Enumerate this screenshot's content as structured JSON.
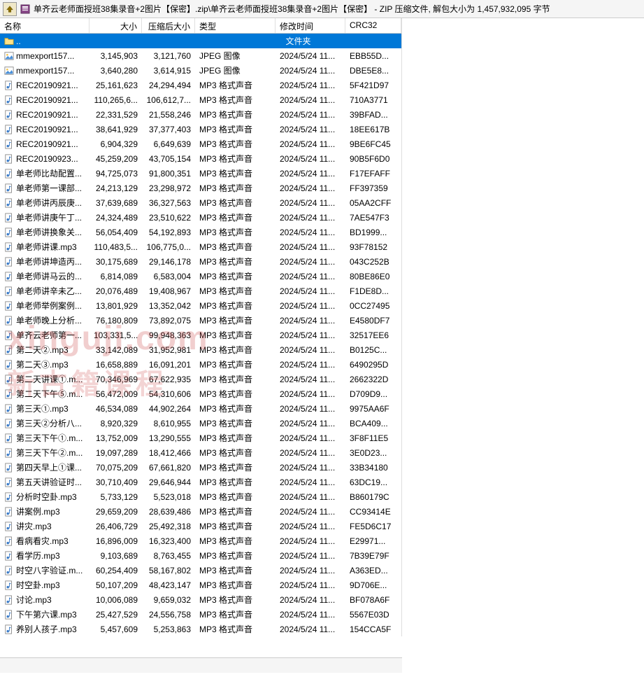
{
  "toolbar": {
    "title_path": "单齐云老师面授班38集录音+2图片【保密】.zip\\单齐云老师面授班38集录音+2图片【保密】 - ZIP 压缩文件, 解包大小为 1,457,932,095 字节"
  },
  "headers": {
    "name": "名称",
    "size": "大小",
    "packed": "压缩后大小",
    "type": "类型",
    "mtime": "修改时间",
    "crc": "CRC32"
  },
  "folder_row": {
    "dots": "..",
    "label": "文件夹"
  },
  "watermark1": "xinguji.com",
  "watermark2": "新古籍课程",
  "files": [
    {
      "name": "mmexport157...",
      "size": "3,145,903",
      "packed": "3,121,760",
      "type": "JPEG 图像",
      "mtime": "2024/5/24 11...",
      "crc": "EBB55D...",
      "icon": "img"
    },
    {
      "name": "mmexport157...",
      "size": "3,640,280",
      "packed": "3,614,915",
      "type": "JPEG 图像",
      "mtime": "2024/5/24 11...",
      "crc": "DBE5E8...",
      "icon": "img"
    },
    {
      "name": "REC20190921...",
      "size": "25,161,623",
      "packed": "24,294,494",
      "type": "MP3 格式声音",
      "mtime": "2024/5/24 11...",
      "crc": "5F421D97",
      "icon": "audio"
    },
    {
      "name": "REC20190921...",
      "size": "110,265,6...",
      "packed": "106,612,7...",
      "type": "MP3 格式声音",
      "mtime": "2024/5/24 11...",
      "crc": "710A3771",
      "icon": "audio"
    },
    {
      "name": "REC20190921...",
      "size": "22,331,529",
      "packed": "21,558,246",
      "type": "MP3 格式声音",
      "mtime": "2024/5/24 11...",
      "crc": "39BFAD...",
      "icon": "audio"
    },
    {
      "name": "REC20190921...",
      "size": "38,641,929",
      "packed": "37,377,403",
      "type": "MP3 格式声音",
      "mtime": "2024/5/24 11...",
      "crc": "18EE617B",
      "icon": "audio"
    },
    {
      "name": "REC20190921...",
      "size": "6,904,329",
      "packed": "6,649,639",
      "type": "MP3 格式声音",
      "mtime": "2024/5/24 11...",
      "crc": "9BE6FC45",
      "icon": "audio"
    },
    {
      "name": "REC20190923...",
      "size": "45,259,209",
      "packed": "43,705,154",
      "type": "MP3 格式声音",
      "mtime": "2024/5/24 11...",
      "crc": "90B5F6D0",
      "icon": "audio"
    },
    {
      "name": "单老师比劫配置...",
      "size": "94,725,073",
      "packed": "91,800,351",
      "type": "MP3 格式声音",
      "mtime": "2024/5/24 11...",
      "crc": "F17EFAFF",
      "icon": "audio"
    },
    {
      "name": "单老师第一课部...",
      "size": "24,213,129",
      "packed": "23,298,972",
      "type": "MP3 格式声音",
      "mtime": "2024/5/24 11...",
      "crc": "FF397359",
      "icon": "audio"
    },
    {
      "name": "单老师讲丙辰庚...",
      "size": "37,639,689",
      "packed": "36,327,563",
      "type": "MP3 格式声音",
      "mtime": "2024/5/24 11...",
      "crc": "05AA2CFF",
      "icon": "audio"
    },
    {
      "name": "单老师讲庚午丁...",
      "size": "24,324,489",
      "packed": "23,510,622",
      "type": "MP3 格式声音",
      "mtime": "2024/5/24 11...",
      "crc": "7AE547F3",
      "icon": "audio"
    },
    {
      "name": "单老师讲换象关...",
      "size": "56,054,409",
      "packed": "54,192,893",
      "type": "MP3 格式声音",
      "mtime": "2024/5/24 11...",
      "crc": "BD1999...",
      "icon": "audio"
    },
    {
      "name": "单老师讲课.mp3",
      "size": "110,483,5...",
      "packed": "106,775,0...",
      "type": "MP3 格式声音",
      "mtime": "2024/5/24 11...",
      "crc": "93F78152",
      "icon": "audio"
    },
    {
      "name": "单老师讲坤造丙...",
      "size": "30,175,689",
      "packed": "29,146,178",
      "type": "MP3 格式声音",
      "mtime": "2024/5/24 11...",
      "crc": "043C252B",
      "icon": "audio"
    },
    {
      "name": "单老师讲马云的...",
      "size": "6,814,089",
      "packed": "6,583,004",
      "type": "MP3 格式声音",
      "mtime": "2024/5/24 11...",
      "crc": "80BE86E0",
      "icon": "audio"
    },
    {
      "name": "单老师讲辛未乙...",
      "size": "20,076,489",
      "packed": "19,408,967",
      "type": "MP3 格式声音",
      "mtime": "2024/5/24 11...",
      "crc": "F1DE8D...",
      "icon": "audio"
    },
    {
      "name": "单老师举例案例...",
      "size": "13,801,929",
      "packed": "13,352,042",
      "type": "MP3 格式声音",
      "mtime": "2024/5/24 11...",
      "crc": "0CC27495",
      "icon": "audio"
    },
    {
      "name": "单老师晚上分析...",
      "size": "76,180,809",
      "packed": "73,892,075",
      "type": "MP3 格式声音",
      "mtime": "2024/5/24 11...",
      "crc": "E4580DF7",
      "icon": "audio"
    },
    {
      "name": "单齐云老师第一...",
      "size": "103,331,5...",
      "packed": "99,948,363",
      "type": "MP3 格式声音",
      "mtime": "2024/5/24 11...",
      "crc": "32517EE6",
      "icon": "audio"
    },
    {
      "name": "第二天②.mp3",
      "size": "33,142,089",
      "packed": "31,952,981",
      "type": "MP3 格式声音",
      "mtime": "2024/5/24 11...",
      "crc": "B0125C...",
      "icon": "audio"
    },
    {
      "name": "第二天③.mp3",
      "size": "16,658,889",
      "packed": "16,091,201",
      "type": "MP3 格式声音",
      "mtime": "2024/5/24 11...",
      "crc": "6490295D",
      "icon": "audio"
    },
    {
      "name": "第二天讲课①.m...",
      "size": "70,346,969",
      "packed": "67,622,935",
      "type": "MP3 格式声音",
      "mtime": "2024/5/24 11...",
      "crc": "2662322D",
      "icon": "audio"
    },
    {
      "name": "第二天下午⑤.m...",
      "size": "56,472,009",
      "packed": "54,310,606",
      "type": "MP3 格式声音",
      "mtime": "2024/5/24 11...",
      "crc": "D709D9...",
      "icon": "audio"
    },
    {
      "name": "第三天①.mp3",
      "size": "46,534,089",
      "packed": "44,902,264",
      "type": "MP3 格式声音",
      "mtime": "2024/5/24 11...",
      "crc": "9975AA6F",
      "icon": "audio"
    },
    {
      "name": "第三天②分析八...",
      "size": "8,920,329",
      "packed": "8,610,955",
      "type": "MP3 格式声音",
      "mtime": "2024/5/24 11...",
      "crc": "BCA409...",
      "icon": "audio"
    },
    {
      "name": "第三天下午①.m...",
      "size": "13,752,009",
      "packed": "13,290,555",
      "type": "MP3 格式声音",
      "mtime": "2024/5/24 11...",
      "crc": "3F8F11E5",
      "icon": "audio"
    },
    {
      "name": "第三天下午②.m...",
      "size": "19,097,289",
      "packed": "18,412,466",
      "type": "MP3 格式声音",
      "mtime": "2024/5/24 11...",
      "crc": "3E0D23...",
      "icon": "audio"
    },
    {
      "name": "第四天早上①课...",
      "size": "70,075,209",
      "packed": "67,661,820",
      "type": "MP3 格式声音",
      "mtime": "2024/5/24 11...",
      "crc": "33B34180",
      "icon": "audio"
    },
    {
      "name": "第五天讲验证时...",
      "size": "30,710,409",
      "packed": "29,646,944",
      "type": "MP3 格式声音",
      "mtime": "2024/5/24 11...",
      "crc": "63DC19...",
      "icon": "audio"
    },
    {
      "name": "分析时空卦.mp3",
      "size": "5,733,129",
      "packed": "5,523,018",
      "type": "MP3 格式声音",
      "mtime": "2024/5/24 11...",
      "crc": "B860179C",
      "icon": "audio"
    },
    {
      "name": "讲案例.mp3",
      "size": "29,659,209",
      "packed": "28,639,486",
      "type": "MP3 格式声音",
      "mtime": "2024/5/24 11...",
      "crc": "CC93414E",
      "icon": "audio"
    },
    {
      "name": "讲灾.mp3",
      "size": "26,406,729",
      "packed": "25,492,318",
      "type": "MP3 格式声音",
      "mtime": "2024/5/24 11...",
      "crc": "FE5D6C17",
      "icon": "audio"
    },
    {
      "name": "看病看灾.mp3",
      "size": "16,896,009",
      "packed": "16,323,400",
      "type": "MP3 格式声音",
      "mtime": "2024/5/24 11...",
      "crc": "E29971...",
      "icon": "audio"
    },
    {
      "name": "看学历.mp3",
      "size": "9,103,689",
      "packed": "8,763,455",
      "type": "MP3 格式声音",
      "mtime": "2024/5/24 11...",
      "crc": "7B39E79F",
      "icon": "audio"
    },
    {
      "name": "时空八字验证.m...",
      "size": "60,254,409",
      "packed": "58,167,802",
      "type": "MP3 格式声音",
      "mtime": "2024/5/24 11...",
      "crc": "A363ED...",
      "icon": "audio"
    },
    {
      "name": "时空卦.mp3",
      "size": "50,107,209",
      "packed": "48,423,147",
      "type": "MP3 格式声音",
      "mtime": "2024/5/24 11...",
      "crc": "9D706E...",
      "icon": "audio"
    },
    {
      "name": "讨论.mp3",
      "size": "10,006,089",
      "packed": "9,659,032",
      "type": "MP3 格式声音",
      "mtime": "2024/5/24 11...",
      "crc": "BF078A6F",
      "icon": "audio"
    },
    {
      "name": "下午第六课.mp3",
      "size": "25,427,529",
      "packed": "24,556,758",
      "type": "MP3 格式声音",
      "mtime": "2024/5/24 11...",
      "crc": "5567E03D",
      "icon": "audio"
    },
    {
      "name": "养别人孩子.mp3",
      "size": "5,457,609",
      "packed": "5,253,863",
      "type": "MP3 格式声音",
      "mtime": "2024/5/24 11...",
      "crc": "154CCA5F",
      "icon": "audio"
    }
  ]
}
